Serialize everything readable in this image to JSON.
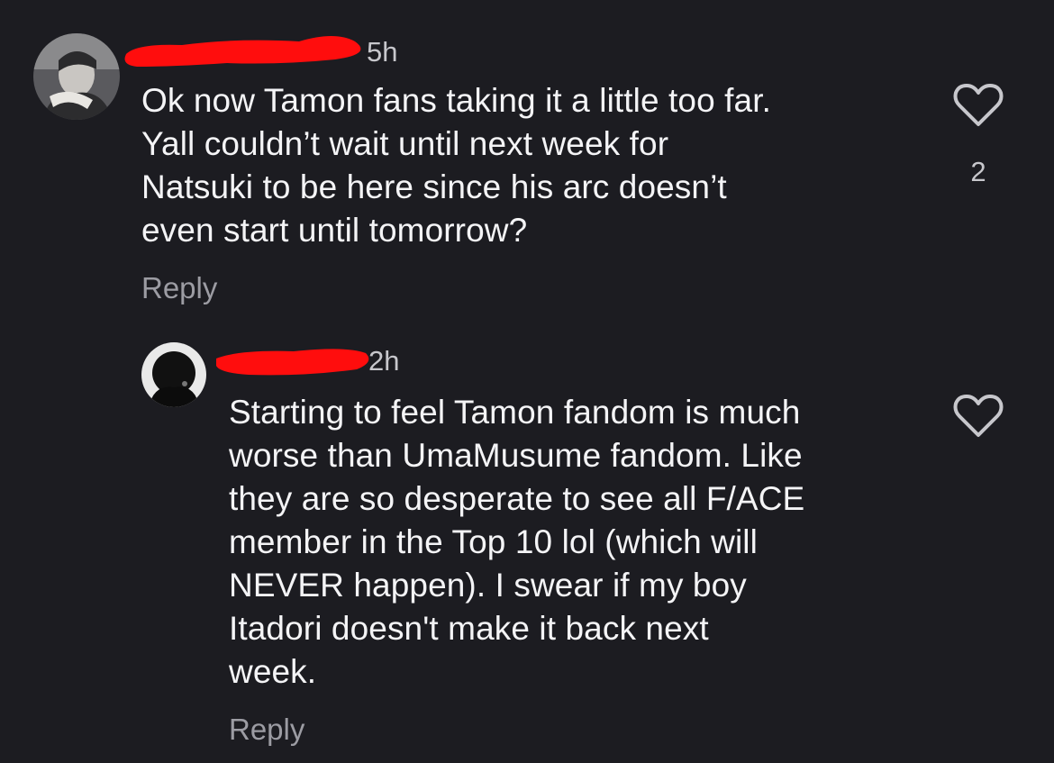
{
  "comments": [
    {
      "time": "5h",
      "text": "Ok now Tamon fans taking it a little too far.\nYall couldn’t wait until next week for\nNatsuki to be here since his arc doesn’t\neven start until tomorrow?",
      "likes": "2",
      "reply_label": "Reply",
      "heart_icon": "heart-outline-icon",
      "avatar_icon": "user-avatar"
    },
    {
      "time": "2h",
      "text": "Starting to feel Tamon fandom is much\nworse than UmaMusume fandom. Like\nthey are so desperate to see all F/ACE\nmember in the Top 10 lol (which will\nNEVER happen). I swear if my boy\nItadori doesn't make it back next\nweek.",
      "reply_label": "Reply",
      "heart_icon": "heart-outline-icon",
      "avatar_icon": "user-avatar"
    }
  ],
  "colors": {
    "background": "#1c1c21",
    "text": "#f4f4f6",
    "muted": "#9c9ca3",
    "redaction": "#ff0d0d"
  }
}
